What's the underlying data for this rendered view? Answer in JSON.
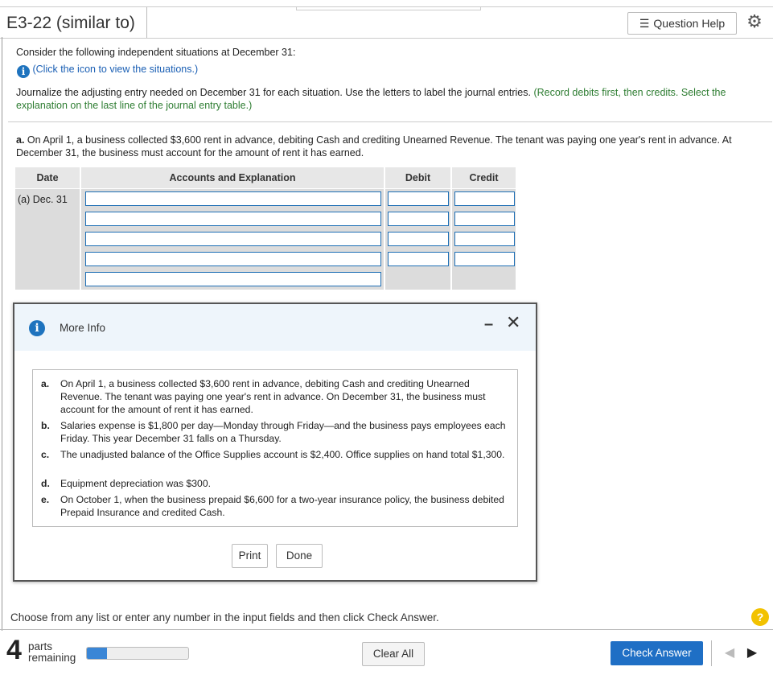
{
  "header": {
    "title": "E3-22 (similar to)",
    "question_help_label": "Question Help"
  },
  "intro": {
    "consider": "Consider the following independent situations at December 31:",
    "click_icon": "(Click the icon to view the situations.)",
    "instructions": "Journalize the adjusting entry needed on December 31 for each situation. Use the letters to label the journal entries.",
    "instructions_note": "(Record debits first, then credits. Select the explanation on the last line of the journal entry table.)"
  },
  "part_a": {
    "label": "a.",
    "text": "On April 1, a business collected $3,600 rent in advance, debiting Cash and crediting Unearned Revenue. The tenant was paying one year's rent in advance. At December 31, the business must account for the amount of rent it has earned."
  },
  "journal": {
    "headers": [
      "Date",
      "Accounts and Explanation",
      "Debit",
      "Credit"
    ],
    "date_label": "(a) Dec. 31",
    "rows": 5
  },
  "modal": {
    "title": "More Info",
    "situations": [
      {
        "letter": "a.",
        "text": "On April 1, a business collected $3,600 rent in advance, debiting Cash and crediting Unearned Revenue. The tenant was paying one year's rent in advance. On December 31, the business must account for the amount of rent it has earned."
      },
      {
        "letter": "b.",
        "text": "Salaries expense is $1,800 per day—Monday through Friday—and the business pays employees each Friday. This year December 31 falls on a Thursday."
      },
      {
        "letter": "c.",
        "text": "The unadjusted balance of the Office Supplies account is $2,400. Office supplies on hand total $1,300."
      },
      {
        "letter": "d.",
        "text": "Equipment depreciation was $300."
      },
      {
        "letter": "e.",
        "text": "On October 1, when the business prepaid $6,600 for a two-year insurance policy, the business debited Prepaid Insurance and credited Cash."
      }
    ],
    "print_label": "Print",
    "done_label": "Done"
  },
  "footer": {
    "message": "Choose from any list or enter any number in the input fields and then click Check Answer.",
    "parts_count": "4",
    "parts_word": "parts",
    "remaining_word": "remaining",
    "progress_fraction": 0.2,
    "clear_all_label": "Clear All",
    "check_answer_label": "Check Answer"
  },
  "colors": {
    "accent_blue": "#1f6fc5",
    "input_border": "#1e6fb5",
    "note_green": "#2e7d32",
    "help_yellow": "#f2c200"
  }
}
